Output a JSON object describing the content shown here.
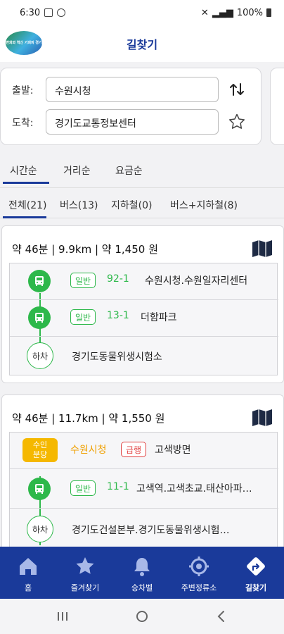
{
  "status": {
    "time": "6:30",
    "battery": "100%"
  },
  "header": {
    "title": "길찾기",
    "logo_text": "변화와 혁신 기회의 경기"
  },
  "search": {
    "origin_label": "출발:",
    "origin_value": "수원시청",
    "dest_label": "도착:",
    "dest_value": "경기도교통정보센터"
  },
  "sort_tabs": [
    "시간순",
    "거리순",
    "요금순"
  ],
  "filter_tabs": [
    "전체(21)",
    "버스(13)",
    "지하철(0)",
    "버스+지하철(8)"
  ],
  "routes": [
    {
      "summary": "약 46분 | 9.9km | 약 1,450 원",
      "steps": [
        {
          "badge": "일반",
          "route_no": "92-1",
          "stop": "수원시청.수원일자리센터"
        },
        {
          "badge": "일반",
          "route_no": "13-1",
          "stop": "더함파크"
        },
        {
          "marker": "하차",
          "stop": "경기도동물위생시험소"
        }
      ]
    },
    {
      "summary": "약 46분 | 11.7km | 약 1,550 원",
      "steps": [
        {
          "subway_line": "수인\n분당",
          "station": "수원시청",
          "badge": "급행",
          "direction": "고색방면"
        },
        {
          "badge": "일반",
          "route_no": "11-1",
          "stop": "고색역.고색초교.태산아파…"
        },
        {
          "marker": "하차",
          "stop": "경기도건설본부.경기도동물위생시험…"
        }
      ]
    }
  ],
  "bottom_nav": [
    {
      "label": "홈",
      "icon": "home-icon"
    },
    {
      "label": "즐겨찾기",
      "icon": "star-icon"
    },
    {
      "label": "승차벨",
      "icon": "bell-icon"
    },
    {
      "label": "주변정류소",
      "icon": "location-icon"
    },
    {
      "label": "길찾기",
      "icon": "directions-icon"
    }
  ],
  "colors": {
    "brand": "#1a3a9a",
    "green": "#2db84a",
    "subway": "#f5b800",
    "express": "#e04040"
  }
}
